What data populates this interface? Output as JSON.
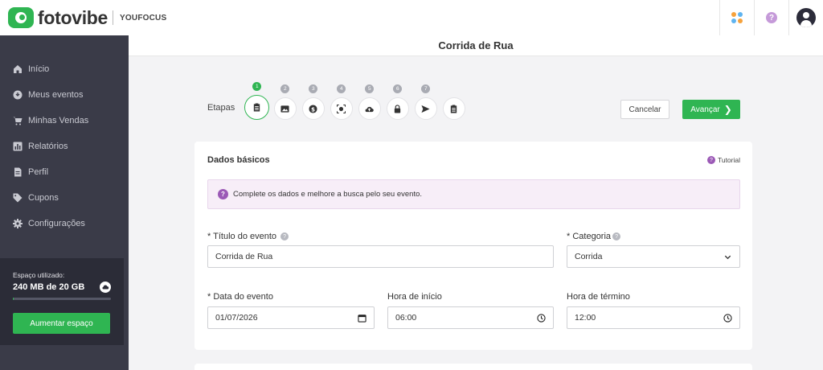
{
  "brand": {
    "name": "fotovibe",
    "sub": "YOUFOCUS"
  },
  "colors": {
    "accent": "#2fb552",
    "sidebar": "#3a3b48",
    "info_bg": "#f7eef8",
    "help": "#9b59b6"
  },
  "sidebar": {
    "items": [
      {
        "label": "Início",
        "icon": "home-icon"
      },
      {
        "label": "Meus eventos",
        "icon": "events-icon"
      },
      {
        "label": "Minhas Vendas",
        "icon": "cart-icon"
      },
      {
        "label": "Relatórios",
        "icon": "chart-icon"
      },
      {
        "label": "Perfil",
        "icon": "profile-icon"
      },
      {
        "label": "Cupons",
        "icon": "tag-icon"
      },
      {
        "label": "Configurações",
        "icon": "gear-icon"
      }
    ],
    "storage": {
      "label": "Espaço utilizado:",
      "value": "240 MB de 20 GB",
      "used_fraction": 0.012,
      "button": "Aumentar espaço"
    }
  },
  "page": {
    "title": "Corrida de Rua"
  },
  "steps": {
    "label": "Etapas",
    "items": [
      {
        "num": "1",
        "icon": "clipboard-icon",
        "active": true
      },
      {
        "num": "2",
        "icon": "image-icon",
        "active": false
      },
      {
        "num": "3",
        "icon": "dollar-icon",
        "active": false
      },
      {
        "num": "4",
        "icon": "face-scan-icon",
        "active": false
      },
      {
        "num": "5",
        "icon": "cloud-upload-icon",
        "active": false
      },
      {
        "num": "6",
        "icon": "lock-icon",
        "active": false
      },
      {
        "num": "7",
        "icon": "send-icon",
        "active": false
      },
      {
        "num": "",
        "icon": "clipboard-icon",
        "active": false
      }
    ]
  },
  "actions": {
    "cancel": "Cancelar",
    "next": "Avançar"
  },
  "form": {
    "title": "Dados básicos",
    "tutorial": "Tutorial",
    "info": "Complete os dados e melhore a busca pelo seu evento.",
    "event_title": {
      "label": "* Título do evento",
      "value": "Corrida de Rua"
    },
    "category": {
      "label": "* Categoria",
      "value": "Corrida"
    },
    "event_date": {
      "label": "* Data do evento",
      "value": "01/07/2026"
    },
    "start_time": {
      "label": "Hora de início",
      "value": "06:00"
    },
    "end_time": {
      "label": "Hora de término",
      "value": "12:00"
    }
  }
}
